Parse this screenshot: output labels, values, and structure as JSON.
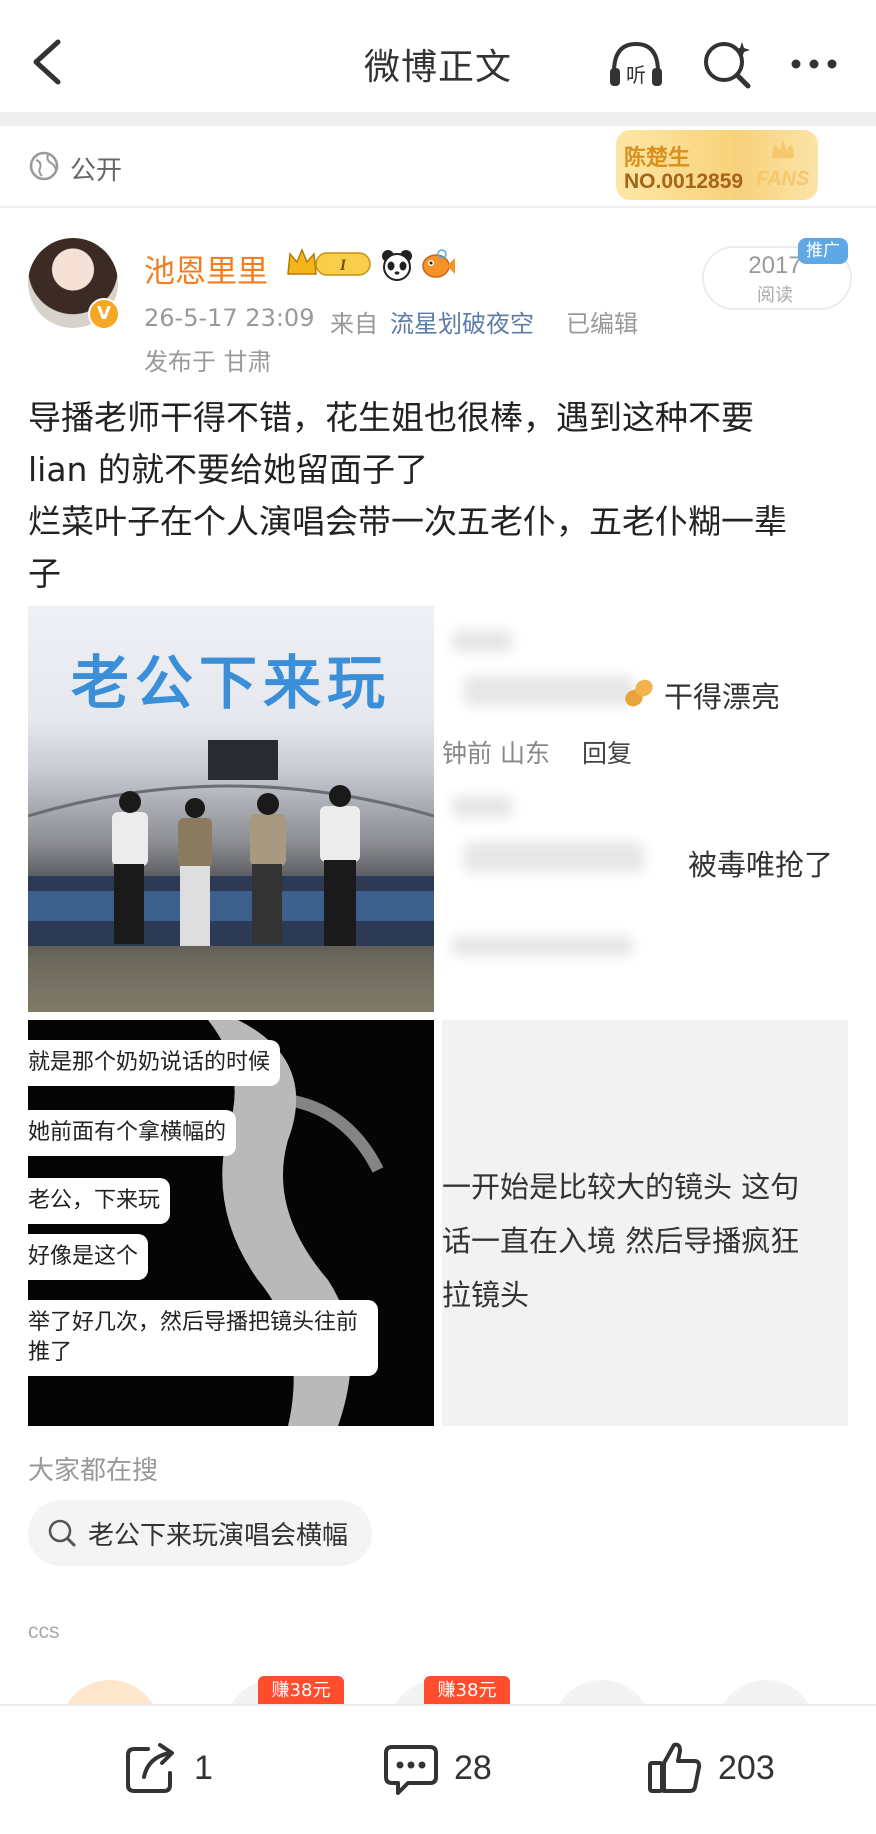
{
  "header": {
    "title": "微博正文",
    "listen_label": "听"
  },
  "visibility": {
    "label": "公开"
  },
  "fan_badge": {
    "name": "陈楚生",
    "number": "NO.0012859",
    "tag": "FANS"
  },
  "author": {
    "name": "池恩里里",
    "level": "I"
  },
  "meta": {
    "time": "26-5-17 23:09",
    "from_label": "来自",
    "source": "流星划破夜空",
    "edited": "已编辑",
    "location": "发布于 甘肃"
  },
  "reads": {
    "count": "2017",
    "label": "阅读",
    "tag": "推广"
  },
  "post": {
    "lines": [
      "导播老师干得不错，花生姐也很棒，遇到这种不要",
      "lian 的就不要给她留面子了",
      "烂菜叶子在个人演唱会带一次五老仆，五老仆糊一辈",
      "子"
    ]
  },
  "images": {
    "img1": {
      "banner": "老公下来玩"
    },
    "img2": {
      "comment1": "干得漂亮",
      "comment1_meta": "钟前 山东",
      "reply": "回复",
      "comment2": "被毒唯抢了"
    },
    "img3": {
      "bubbles": [
        "就是那个奶奶说话的时候",
        "她前面有个拿横幅的",
        "老公，下来玩",
        "好像是这个",
        "举了好几次，然后导播把镜头往前",
        "推了"
      ]
    },
    "img4": {
      "lines": [
        "一开始是比较大的镜头 这句",
        "话一直在入境 然后导播疯狂",
        "拉镜头"
      ]
    }
  },
  "search": {
    "heading": "大家都在搜",
    "chip": "老公下来玩演唱会横幅"
  },
  "recommend": {
    "label": "ccs",
    "earn1": "赚38元",
    "earn2": "赚38元"
  },
  "actions": {
    "repost": "1",
    "comment": "28",
    "like": "203"
  },
  "colors": {
    "username": "#f27e22",
    "link": "#5d7ca6",
    "earn": "#ff4d2d"
  }
}
